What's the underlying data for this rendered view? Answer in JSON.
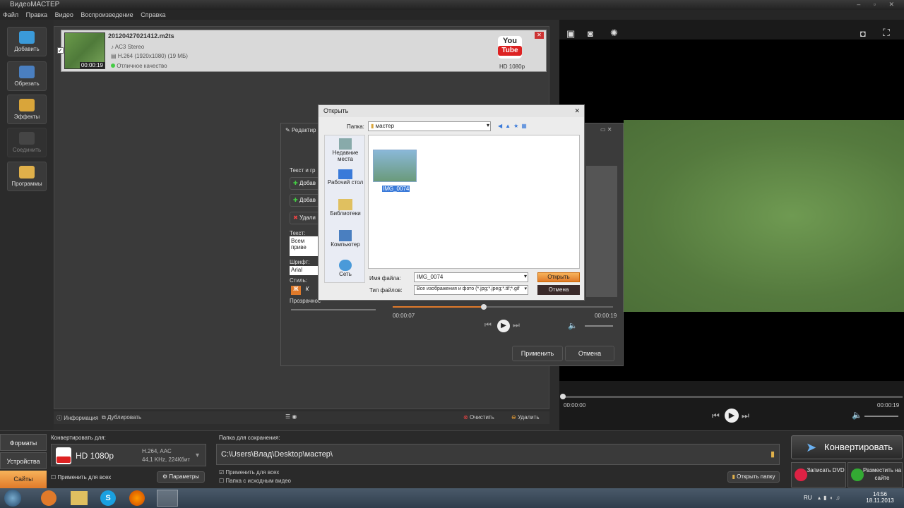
{
  "window": {
    "title": "ВидеоМАСТЕР"
  },
  "menu": [
    "Файл",
    "Правка",
    "Видео",
    "Воспроизведение",
    "Справка"
  ],
  "sidebar": [
    {
      "label": "Добавить"
    },
    {
      "label": "Обрезать"
    },
    {
      "label": "Эффекты"
    },
    {
      "label": "Соединить"
    },
    {
      "label": "Программы"
    }
  ],
  "file": {
    "name": "20120427021412.m2ts",
    "audio": "AC3 Stereo",
    "video": "H.264 (1920x1080) (19 МБ)",
    "quality": "Отличное качество",
    "duration": "00:00:19",
    "preset_label": "HD 1080p",
    "yt_top": "You",
    "yt_bottom": "Tube"
  },
  "editor": {
    "title": "Редактир",
    "section": "Текст и гр",
    "btn_add1": "Добав",
    "btn_add2": "Добав",
    "btn_del": "Удали",
    "text_label": "Текст:",
    "text_value": "Всем приве",
    "font_label": "Шрифт:",
    "font_value": "Arial",
    "style_label": "Стиль:",
    "bold": "Ж",
    "italic": "К",
    "opacity_label": "Прозрачнос",
    "time_cur": "00:00:07",
    "time_total": "00:00:19",
    "apply": "Применить",
    "cancel": "Отмена"
  },
  "open_dialog": {
    "title": "Открыть",
    "folder_label": "Папка:",
    "folder_value": "мастер",
    "places": [
      "Недавние места",
      "Рабочий стол",
      "Библиотеки",
      "Компьютер",
      "Сеть"
    ],
    "file_item": "IMG_0074",
    "filename_label": "Имя файла:",
    "filename_value": "IMG_0074",
    "filetype_label": "Тип файлов:",
    "filetype_value": "Все изображения и фото (*.jpg;*.jpeg;*.tif;*.gif",
    "open": "Открыть",
    "cancel": "Отмена"
  },
  "main_toolbar": {
    "info": "Информация",
    "dup": "Дублировать",
    "clear": "Очистить",
    "delete": "Удалить"
  },
  "preview": {
    "time_start": "00:00:00",
    "time_end": "00:00:19"
  },
  "bottom": {
    "tabs": [
      "Форматы",
      "Устройства",
      "Сайты"
    ],
    "convert_for_label": "Конвертировать для:",
    "preset": "HD 1080p",
    "codec": "H.264, AAC",
    "codec2": "44,1 KHz, 224Кбит",
    "apply_all": "Применить для всех",
    "params": "Параметры",
    "save_label": "Папка для сохранения:",
    "save_path": "C:\\Users\\Влад\\Desktop\\мастер\\",
    "apply_all2": "Применить для всех",
    "src_folder": "Папка с исходным видео",
    "open_folder": "Открыть папку",
    "convert": "Конвертировать",
    "burn_dvd": "Записать DVD",
    "publish": "Разместить на сайте"
  },
  "taskbar": {
    "lang": "RU",
    "time": "14:56",
    "date": "18.11.2013"
  }
}
